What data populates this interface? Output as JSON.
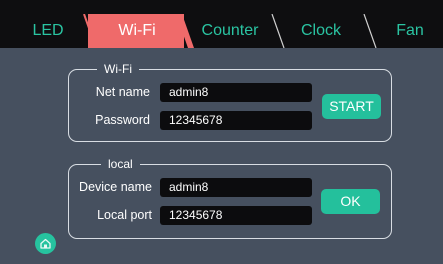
{
  "tabs": [
    {
      "label": "LED",
      "active": false
    },
    {
      "label": "Wi-Fi",
      "active": true
    },
    {
      "label": "Counter",
      "active": false
    },
    {
      "label": "Clock",
      "active": false
    },
    {
      "label": "Fan",
      "active": false
    }
  ],
  "wifi": {
    "legend": "Wi-Fi",
    "net_name_label": "Net name",
    "net_name_value": "admin8",
    "password_label": "Password",
    "password_value": "12345678",
    "start_label": "START"
  },
  "local": {
    "legend": "local",
    "device_name_label": "Device name",
    "device_name_value": "admin8",
    "local_port_label": "Local port",
    "local_port_value": "12345678",
    "ok_label": "OK"
  },
  "colors": {
    "background": "#46505f",
    "topbar": "#0e0e10",
    "active_tab": "#ef6a6a",
    "accent": "#24c09c",
    "tab_text": "#2ac4a2"
  },
  "icons": {
    "home": "home-icon"
  }
}
